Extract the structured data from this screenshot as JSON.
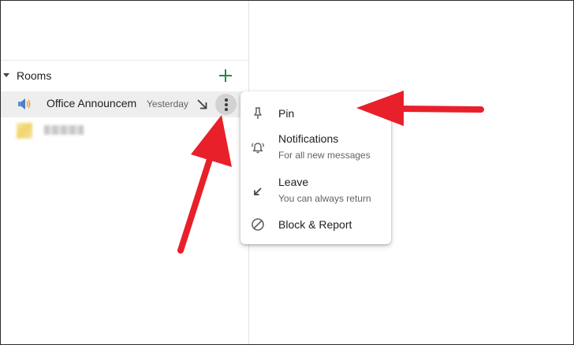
{
  "sidebar": {
    "section_label": "Rooms",
    "rooms": [
      {
        "name": "Office Announcements",
        "time": "Yesterday"
      }
    ]
  },
  "menu": {
    "items": [
      {
        "label": "Pin",
        "sub": ""
      },
      {
        "label": "Notifications",
        "sub": "For all new messages"
      },
      {
        "label": "Leave",
        "sub": "You can always return"
      },
      {
        "label": "Block & Report",
        "sub": ""
      }
    ]
  },
  "colors": {
    "accent_green": "#1e8e3e",
    "annotation_red": "#e8202a",
    "row_highlight": "#eeeeee"
  },
  "icons": [
    "plus-icon",
    "speaker-icon",
    "snooze-icon",
    "more-vert-icon",
    "pin-icon",
    "bell-icon",
    "leave-icon",
    "block-icon"
  ]
}
